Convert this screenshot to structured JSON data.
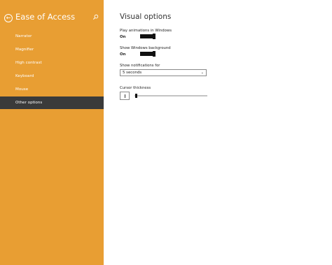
{
  "sidebar": {
    "title": "Ease of Access",
    "items": [
      {
        "label": "Narrator"
      },
      {
        "label": "Magnifier"
      },
      {
        "label": "High contrast"
      },
      {
        "label": "Keyboard"
      },
      {
        "label": "Mouse"
      },
      {
        "label": "Other options",
        "active": true
      }
    ],
    "accent_color": "#e89e33",
    "active_color": "#3a3a3a"
  },
  "main": {
    "title": "Visual options",
    "play_animations": {
      "label": "Play animations in Windows",
      "state": "On"
    },
    "show_background": {
      "label": "Show Windows background",
      "state": "On"
    },
    "notifications": {
      "label": "Show notifications for",
      "value": "5 seconds"
    },
    "cursor_thickness": {
      "label": "Cursor thickness",
      "value": 1
    }
  },
  "icons": {
    "back": "back-arrow-icon",
    "search": "search-icon",
    "dropdown": "chevron-down-icon"
  }
}
